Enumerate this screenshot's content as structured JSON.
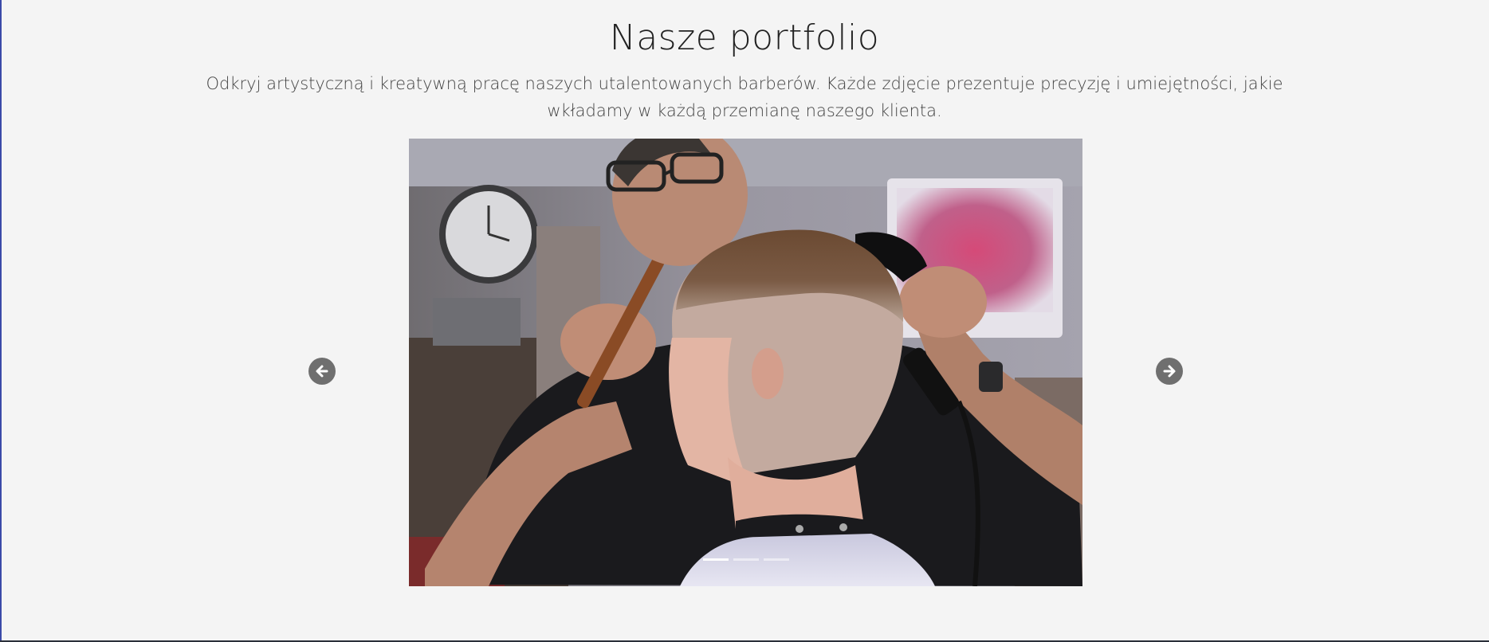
{
  "portfolio": {
    "title": "Nasze portfolio",
    "subtitle": "Odkryj artystyczną i kreatywną pracę naszych utalentowanych barberów. Każde zdjęcie prezentuje precyzję i umiejętności, jakie wkładamy w każdą przemianę naszego klienta."
  },
  "carousel": {
    "image_icon": "barber-cutting-hair-photo",
    "prev_icon": "arrow-left-icon",
    "next_icon": "arrow-right-icon",
    "slide_count": 3,
    "active_slide": 1
  },
  "colors": {
    "background": "#f4f4f4",
    "arrow": "#6f6f6f",
    "left_edge": "#3b4aa8"
  }
}
